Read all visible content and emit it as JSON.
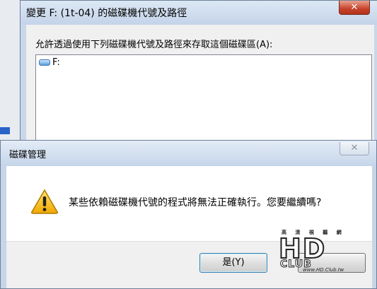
{
  "background_dialog": {
    "title": "變更 F: (1t-04) 的磁碟機代號及路徑",
    "close_glyph": "✕",
    "prompt": "允許透過使用下列磁碟機代號及路徑來存取這個磁碟區(A):",
    "items": [
      "F:"
    ]
  },
  "confirm_dialog": {
    "title": "磁碟管理",
    "close_glyph": "✕",
    "message": "某些依賴磁碟機代號的程式將無法正確執行。您要繼續嗎?",
    "icon": "warning-icon",
    "yes_label": "是(Y)",
    "no_label": ""
  },
  "watermark": {
    "small_text": "高 清 視 聽 網",
    "main_text": "HD",
    "club_text": "CLUB",
    "url": "www.HD.Club.tw"
  },
  "colors": {
    "title_bar": "#c9d7ea",
    "close_red": "#c7422b",
    "warning_yellow": "#f5c400"
  }
}
